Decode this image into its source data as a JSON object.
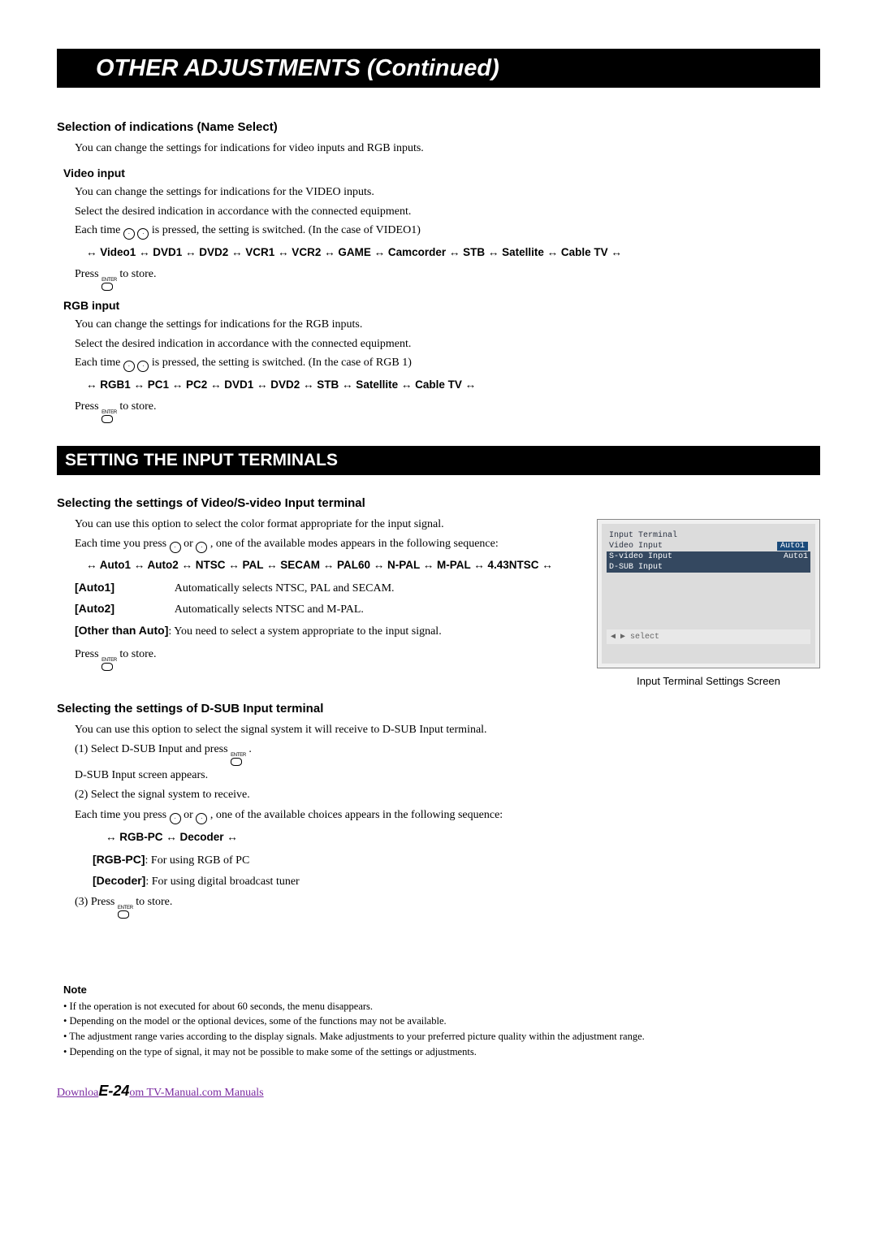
{
  "title": "OTHER ADJUSTMENTS (Continued)",
  "sec1": {
    "heading": "Selection of indications (Name Select)",
    "intro": "You can change the settings for indications for video inputs and RGB inputs.",
    "video": {
      "heading": "Video input",
      "p1": "You can change the settings for indications for the VIDEO inputs.",
      "p2": "Select the desired indication in accordance with the connected equipment.",
      "p3a": "Each time ",
      "p3b": " is pressed, the setting is switched. (In the case of VIDEO1)",
      "seq": "↔ Video1 ↔ DVD1 ↔ DVD2 ↔ VCR1 ↔ VCR2 ↔ GAME ↔ Camcorder ↔ STB ↔ Satellite ↔ Cable TV ↔",
      "store_a": "Press ",
      "store_b": " to store."
    },
    "rgb": {
      "heading": "RGB input",
      "p1": "You can change the settings for indications for the RGB inputs.",
      "p2": "Select the desired indication in accordance with the connected equipment.",
      "p3a": "Each time ",
      "p3b": " is pressed, the setting is switched. (In the case of RGB 1)",
      "seq": "↔ RGB1 ↔ PC1 ↔ PC2 ↔ DVD1 ↔ DVD2 ↔ STB ↔ Satellite ↔ Cable TV ↔",
      "store_a": "Press ",
      "store_b": " to store."
    }
  },
  "band": "SETTING THE INPUT TERMINALS",
  "sec2": {
    "heading": "Selecting the settings of Video/S-video Input terminal",
    "p1": "You can use this option to select the color format appropriate for the input signal.",
    "p2a": "Each time you press ",
    "p2mid": " or ",
    "p2b": ", one of the available modes appears in the following sequence:",
    "seq": "↔ Auto1 ↔ Auto2 ↔ NTSC ↔ PAL ↔ SECAM ↔ PAL60 ↔ N-PAL ↔ M-PAL ↔ 4.43NTSC ↔",
    "auto1_l": "[Auto1]",
    "auto1_v": "Automatically selects NTSC, PAL and SECAM.",
    "auto2_l": "[Auto2]",
    "auto2_v": "Automatically selects NTSC and M-PAL.",
    "other_l": "[Other than Auto]",
    "other_v": ": You need to select a system appropriate to the input signal.",
    "store_a": "Press ",
    "store_b": " to store."
  },
  "screen": {
    "r1": "Input Terminal",
    "r2l": "Video Input",
    "r2r": "Auto1",
    "r3l": "S-video Input",
    "r3r": "Auto1",
    "r4l": "D-SUB Input",
    "r4r": " ",
    "bottom": "◀ ▶  select",
    "caption": "Input Terminal Settings Screen"
  },
  "sec3": {
    "heading": "Selecting the settings of D-SUB Input terminal",
    "p1": "You can use this option to select the signal system it will receive to D-SUB Input terminal.",
    "s1a": "(1) Select D-SUB Input and press ",
    "s1b": ".",
    "s1sub": "D-SUB Input screen appears.",
    "s2": "(2) Select the signal system to receive.",
    "s2suba": "Each time you press ",
    "s2mid": " or ",
    "s2subb": ", one of the available choices appears in the following sequence:",
    "seq": "↔ RGB-PC ↔ Decoder ↔",
    "rgbpc_l": "[RGB-PC]",
    "rgbpc_v": ": For using RGB of PC",
    "dec_l": "[Decoder]",
    "dec_v": ": For using digital broadcast tuner",
    "s3a": "(3) Press ",
    "s3b": " to store."
  },
  "note_h": "Note",
  "notes": [
    "If the operation is not executed for about 60 seconds, the menu disappears.",
    "Depending on the model or the optional devices, some of the functions may not be available.",
    "The adjustment range varies according to the display signals. Make adjustments to your preferred picture quality within the adjustment range.",
    "Depending on the type of signal, it may not be possible to make some of the settings or adjustments."
  ],
  "footer": {
    "pre": "Downloa",
    "page": "E-24",
    "post": "om TV-Manual.com Manuals"
  },
  "enter_label": "ENTER"
}
